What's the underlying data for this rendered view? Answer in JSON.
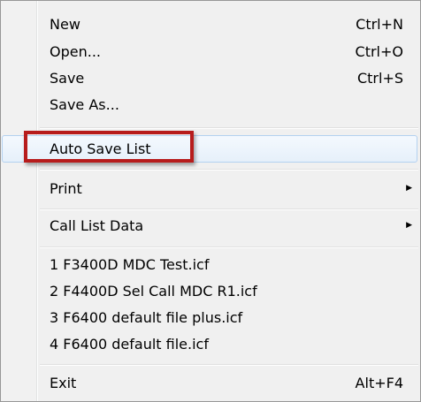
{
  "menu": {
    "items": [
      {
        "label": "New",
        "shortcut": "Ctrl+N"
      },
      {
        "label": "Open...",
        "shortcut": "Ctrl+O"
      },
      {
        "label": "Save",
        "shortcut": "Ctrl+S"
      },
      {
        "label": "Save As...",
        "shortcut": ""
      },
      {
        "label": "Auto Save List",
        "shortcut": ""
      },
      {
        "label": "Print",
        "shortcut": ""
      },
      {
        "label": "Call List Data",
        "shortcut": ""
      },
      {
        "label": "1 F3400D MDC Test.icf",
        "shortcut": ""
      },
      {
        "label": "2 F4400D Sel Call MDC R1.icf",
        "shortcut": ""
      },
      {
        "label": "3 F6400 default file plus.icf",
        "shortcut": ""
      },
      {
        "label": "4 F6400 default file.icf",
        "shortcut": ""
      },
      {
        "label": "Exit",
        "shortcut": "Alt+F4"
      }
    ],
    "submenu_arrow": "▶",
    "highlight_color": "#b71c1c"
  }
}
